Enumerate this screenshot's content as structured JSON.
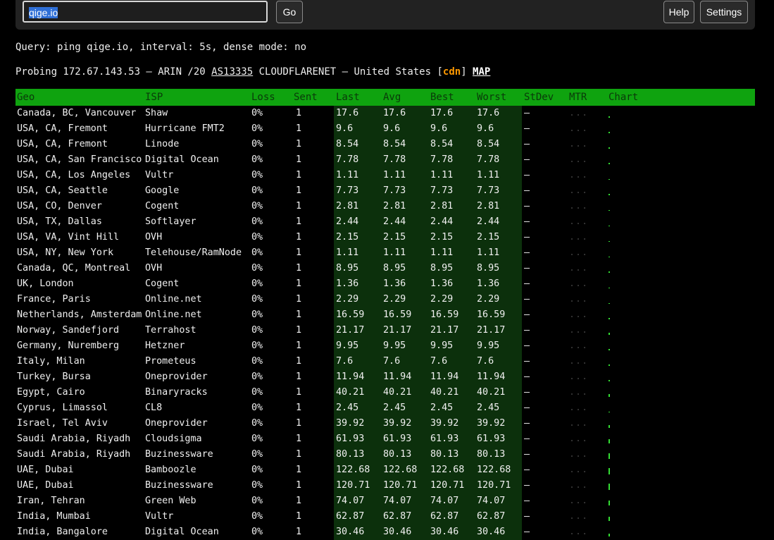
{
  "toolbar": {
    "query_value": "qige.io",
    "go_label": "Go",
    "help_label": "Help",
    "settings_label": "Settings"
  },
  "info": {
    "query_line": "Query: ping qige.io, interval: 5s, dense mode: no",
    "probe_prefix": "Probing 172.67.143.53 — ARIN /20 ",
    "asn": "AS13335",
    "probe_middle": " CLOUDFLARENET — United States [",
    "cdn": "cdn",
    "probe_close": "] ",
    "map": "MAP"
  },
  "table": {
    "headers": {
      "geo": "Geo",
      "isp": "ISP",
      "loss": "Loss",
      "sent": "Sent",
      "last": "Last",
      "avg": "Avg",
      "best": "Best",
      "worst": "Worst",
      "stdev": "StDev",
      "mtr": "MTR",
      "chart": "Chart"
    },
    "mtr_placeholder": "...",
    "rows": [
      {
        "geo": "Canada, BC, Vancouver",
        "isp": "Shaw",
        "loss": "0%",
        "sent": "1",
        "last": "17.6",
        "avg": "17.6",
        "best": "17.6",
        "worst": "17.6",
        "stdev": "–"
      },
      {
        "geo": "USA, CA, Fremont",
        "isp": "Hurricane FMT2",
        "loss": "0%",
        "sent": "1",
        "last": "9.6",
        "avg": "9.6",
        "best": "9.6",
        "worst": "9.6",
        "stdev": "–"
      },
      {
        "geo": "USA, CA, Fremont",
        "isp": "Linode",
        "loss": "0%",
        "sent": "1",
        "last": "8.54",
        "avg": "8.54",
        "best": "8.54",
        "worst": "8.54",
        "stdev": "–"
      },
      {
        "geo": "USA, CA, San Francisco",
        "isp": "Digital Ocean",
        "loss": "0%",
        "sent": "1",
        "last": "7.78",
        "avg": "7.78",
        "best": "7.78",
        "worst": "7.78",
        "stdev": "–"
      },
      {
        "geo": "USA, CA, Los Angeles",
        "isp": "Vultr",
        "loss": "0%",
        "sent": "1",
        "last": "1.11",
        "avg": "1.11",
        "best": "1.11",
        "worst": "1.11",
        "stdev": "–"
      },
      {
        "geo": "USA, CA, Seattle",
        "isp": "Google",
        "loss": "0%",
        "sent": "1",
        "last": "7.73",
        "avg": "7.73",
        "best": "7.73",
        "worst": "7.73",
        "stdev": "–"
      },
      {
        "geo": "USA, CO, Denver",
        "isp": "Cogent",
        "loss": "0%",
        "sent": "1",
        "last": "2.81",
        "avg": "2.81",
        "best": "2.81",
        "worst": "2.81",
        "stdev": "–"
      },
      {
        "geo": "USA, TX, Dallas",
        "isp": "Softlayer",
        "loss": "0%",
        "sent": "1",
        "last": "2.44",
        "avg": "2.44",
        "best": "2.44",
        "worst": "2.44",
        "stdev": "–"
      },
      {
        "geo": "USA, VA, Vint Hill",
        "isp": "OVH",
        "loss": "0%",
        "sent": "1",
        "last": "2.15",
        "avg": "2.15",
        "best": "2.15",
        "worst": "2.15",
        "stdev": "–"
      },
      {
        "geo": "USA, NY, New York",
        "isp": "Telehouse/RamNode",
        "loss": "0%",
        "sent": "1",
        "last": "1.11",
        "avg": "1.11",
        "best": "1.11",
        "worst": "1.11",
        "stdev": "–"
      },
      {
        "geo": "Canada, QC, Montreal",
        "isp": "OVH",
        "loss": "0%",
        "sent": "1",
        "last": "8.95",
        "avg": "8.95",
        "best": "8.95",
        "worst": "8.95",
        "stdev": "–"
      },
      {
        "geo": "UK, London",
        "isp": "Cogent",
        "loss": "0%",
        "sent": "1",
        "last": "1.36",
        "avg": "1.36",
        "best": "1.36",
        "worst": "1.36",
        "stdev": "–"
      },
      {
        "geo": "France, Paris",
        "isp": "Online.net",
        "loss": "0%",
        "sent": "1",
        "last": "2.29",
        "avg": "2.29",
        "best": "2.29",
        "worst": "2.29",
        "stdev": "–"
      },
      {
        "geo": "Netherlands, Amsterdam",
        "isp": "Online.net",
        "loss": "0%",
        "sent": "1",
        "last": "16.59",
        "avg": "16.59",
        "best": "16.59",
        "worst": "16.59",
        "stdev": "–"
      },
      {
        "geo": "Norway, Sandefjord",
        "isp": "Terrahost",
        "loss": "0%",
        "sent": "1",
        "last": "21.17",
        "avg": "21.17",
        "best": "21.17",
        "worst": "21.17",
        "stdev": "–"
      },
      {
        "geo": "Germany, Nuremberg",
        "isp": "Hetzner",
        "loss": "0%",
        "sent": "1",
        "last": "9.95",
        "avg": "9.95",
        "best": "9.95",
        "worst": "9.95",
        "stdev": "–"
      },
      {
        "geo": "Italy, Milan",
        "isp": "Prometeus",
        "loss": "0%",
        "sent": "1",
        "last": "7.6",
        "avg": "7.6",
        "best": "7.6",
        "worst": "7.6",
        "stdev": "–"
      },
      {
        "geo": "Turkey, Bursa",
        "isp": "Oneprovider",
        "loss": "0%",
        "sent": "1",
        "last": "11.94",
        "avg": "11.94",
        "best": "11.94",
        "worst": "11.94",
        "stdev": "–"
      },
      {
        "geo": "Egypt, Cairo",
        "isp": "Binaryracks",
        "loss": "0%",
        "sent": "1",
        "last": "40.21",
        "avg": "40.21",
        "best": "40.21",
        "worst": "40.21",
        "stdev": "–"
      },
      {
        "geo": "Cyprus, Limassol",
        "isp": "CL8",
        "loss": "0%",
        "sent": "1",
        "last": "2.45",
        "avg": "2.45",
        "best": "2.45",
        "worst": "2.45",
        "stdev": "–"
      },
      {
        "geo": "Israel, Tel Aviv",
        "isp": "Oneprovider",
        "loss": "0%",
        "sent": "1",
        "last": "39.92",
        "avg": "39.92",
        "best": "39.92",
        "worst": "39.92",
        "stdev": "–"
      },
      {
        "geo": "Saudi Arabia, Riyadh",
        "isp": "Cloudsigma",
        "loss": "0%",
        "sent": "1",
        "last": "61.93",
        "avg": "61.93",
        "best": "61.93",
        "worst": "61.93",
        "stdev": "–"
      },
      {
        "geo": "Saudi Arabia, Riyadh",
        "isp": "Buzinessware",
        "loss": "0%",
        "sent": "1",
        "last": "80.13",
        "avg": "80.13",
        "best": "80.13",
        "worst": "80.13",
        "stdev": "–"
      },
      {
        "geo": "UAE, Dubai",
        "isp": "Bamboozle",
        "loss": "0%",
        "sent": "1",
        "last": "122.68",
        "avg": "122.68",
        "best": "122.68",
        "worst": "122.68",
        "stdev": "–"
      },
      {
        "geo": "UAE, Dubai",
        "isp": "Buzinessware",
        "loss": "0%",
        "sent": "1",
        "last": "120.71",
        "avg": "120.71",
        "best": "120.71",
        "worst": "120.71",
        "stdev": "–"
      },
      {
        "geo": "Iran, Tehran",
        "isp": "Green Web",
        "loss": "0%",
        "sent": "1",
        "last": "74.07",
        "avg": "74.07",
        "best": "74.07",
        "worst": "74.07",
        "stdev": "–"
      },
      {
        "geo": "India, Mumbai",
        "isp": "Vultr",
        "loss": "0%",
        "sent": "1",
        "last": "62.87",
        "avg": "62.87",
        "best": "62.87",
        "worst": "62.87",
        "stdev": "–"
      },
      {
        "geo": "India, Bangalore",
        "isp": "Digital Ocean",
        "loss": "0%",
        "sent": "1",
        "last": "30.46",
        "avg": "30.46",
        "best": "30.46",
        "worst": "30.46",
        "stdev": "–"
      }
    ]
  }
}
